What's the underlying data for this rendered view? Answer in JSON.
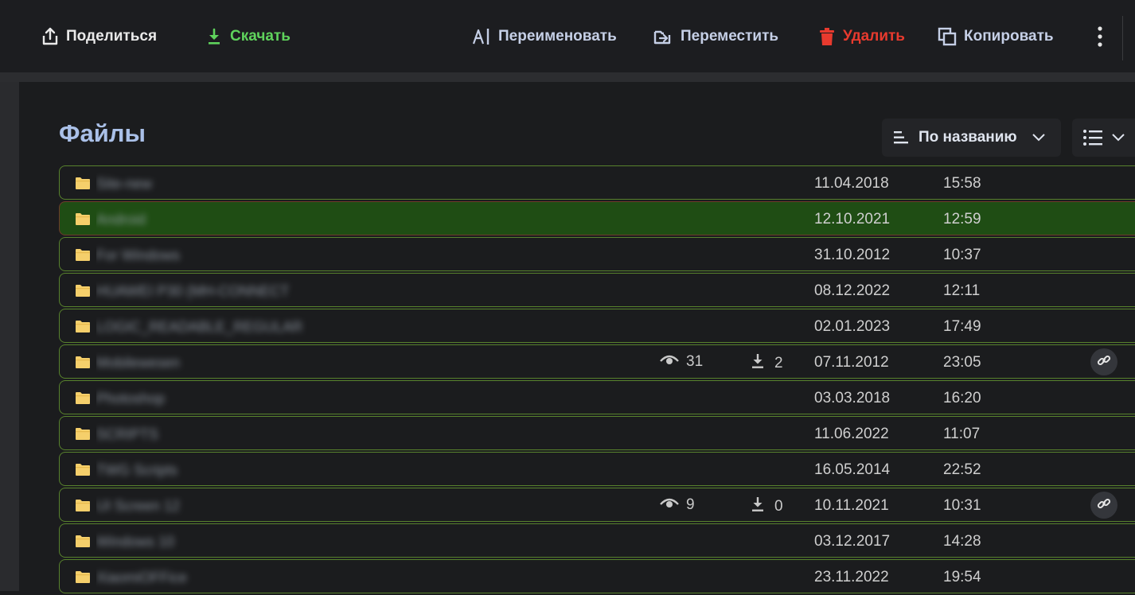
{
  "toolbar": {
    "share_label": "Поделиться",
    "download_label": "Скачать",
    "rename_label": "Переименовать",
    "move_label": "Переместить",
    "delete_label": "Удалить",
    "copy_label": "Копировать"
  },
  "colors": {
    "download": "#5fd35c",
    "delete": "#e83a2e",
    "title": "#aac0e8",
    "row_border": "#58822d",
    "selected_row": "#1f4d14"
  },
  "page_title": "Файлы",
  "sort": {
    "label": "По названию"
  },
  "rows": [
    {
      "name": "Site-new",
      "date": "11.04.2018",
      "time": "15:58"
    },
    {
      "name": "Android",
      "date": "12.10.2021",
      "time": "12:59",
      "selected": true
    },
    {
      "name": "For Windows",
      "date": "31.10.2012",
      "time": "10:37"
    },
    {
      "name": "HUAWEI P30 (MH-CONNECT",
      "date": "08.12.2022",
      "time": "12:11"
    },
    {
      "name": "LOGIC_READABLE_REGULAR",
      "date": "02.01.2023",
      "time": "17:49"
    },
    {
      "name": "Mobilewesen",
      "views": "31",
      "downloads": "2",
      "date": "07.11.2012",
      "time": "23:05",
      "shared": true
    },
    {
      "name": "Photoshop",
      "date": "03.03.2018",
      "time": "16:20"
    },
    {
      "name": "SCRIPTS",
      "date": "11.06.2022",
      "time": "11:07"
    },
    {
      "name": "TWG Scripts",
      "date": "16.05.2014",
      "time": "22:52"
    },
    {
      "name": "UI Screen 12",
      "views": "9",
      "downloads": "0",
      "date": "10.11.2021",
      "time": "10:31",
      "shared": true
    },
    {
      "name": "Windows 10",
      "date": "03.12.2017",
      "time": "14:28"
    },
    {
      "name": "XiaomiOFFice",
      "date": "23.11.2022",
      "time": "19:54"
    }
  ]
}
